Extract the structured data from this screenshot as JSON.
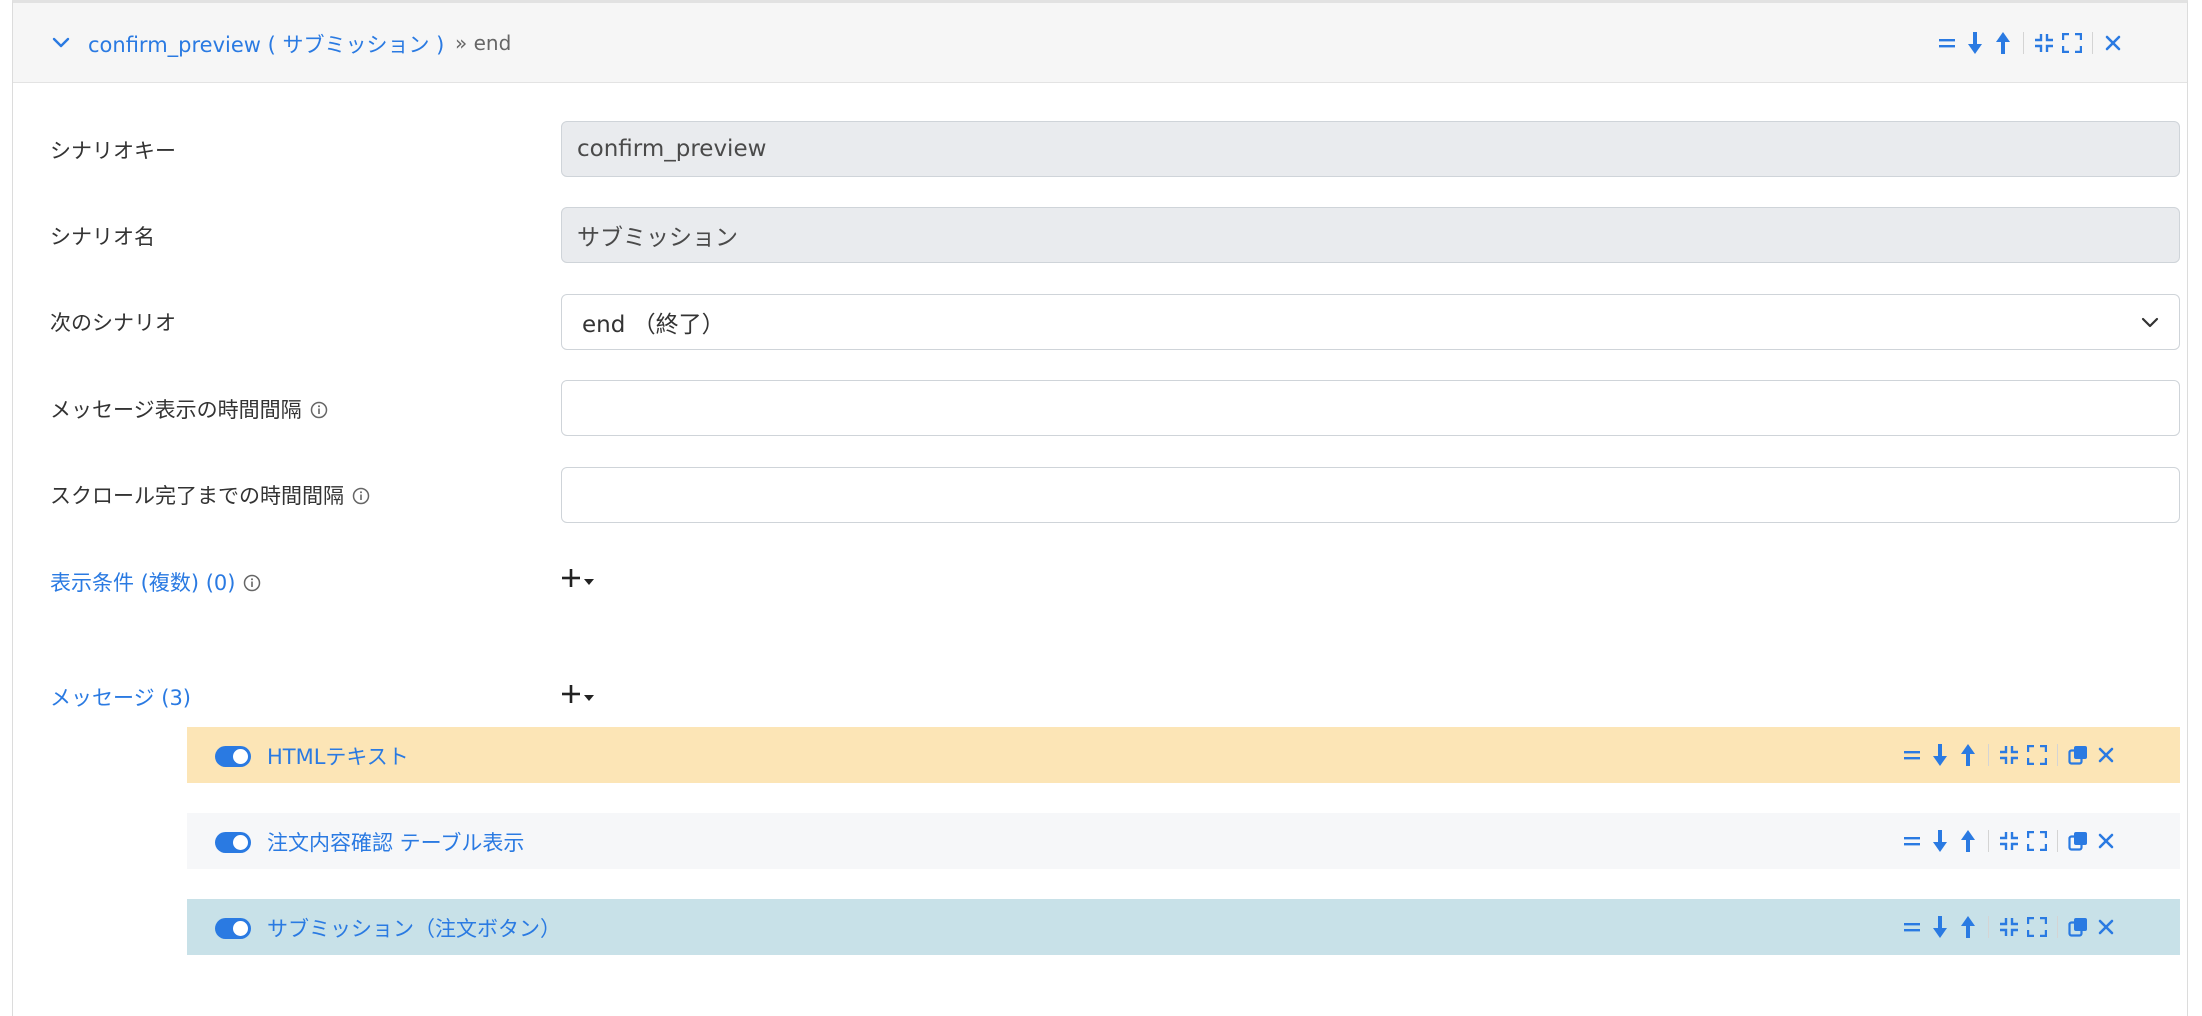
{
  "header": {
    "title": "confirm_preview ( サブミッション )",
    "next": "» end"
  },
  "form": {
    "scenario_key": {
      "label": "シナリオキー",
      "value": "confirm_preview"
    },
    "scenario_name": {
      "label": "シナリオ名",
      "value": "サブミッション"
    },
    "next_scenario": {
      "label": "次のシナリオ",
      "value": "end （終了）"
    },
    "message_interval": {
      "label": "メッセージ表示の時間間隔",
      "value": ""
    },
    "scroll_interval": {
      "label": "スクロール完了までの時間間隔",
      "value": ""
    },
    "conditions": {
      "label": "表示条件 (複数) (0)"
    },
    "messages": {
      "label": "メッセージ (3)"
    }
  },
  "messages": [
    {
      "label": "HTMLテキスト",
      "bg": "#fce5b6"
    },
    {
      "label": "注文内容確認 テーブル表示",
      "bg": "#f6f7f9"
    },
    {
      "label": "サブミッション（注文ボタン）",
      "bg": "#c8e1e8"
    }
  ],
  "colors": {
    "accent": "#2a7ae2",
    "readonly_bg": "#e9ebee"
  }
}
